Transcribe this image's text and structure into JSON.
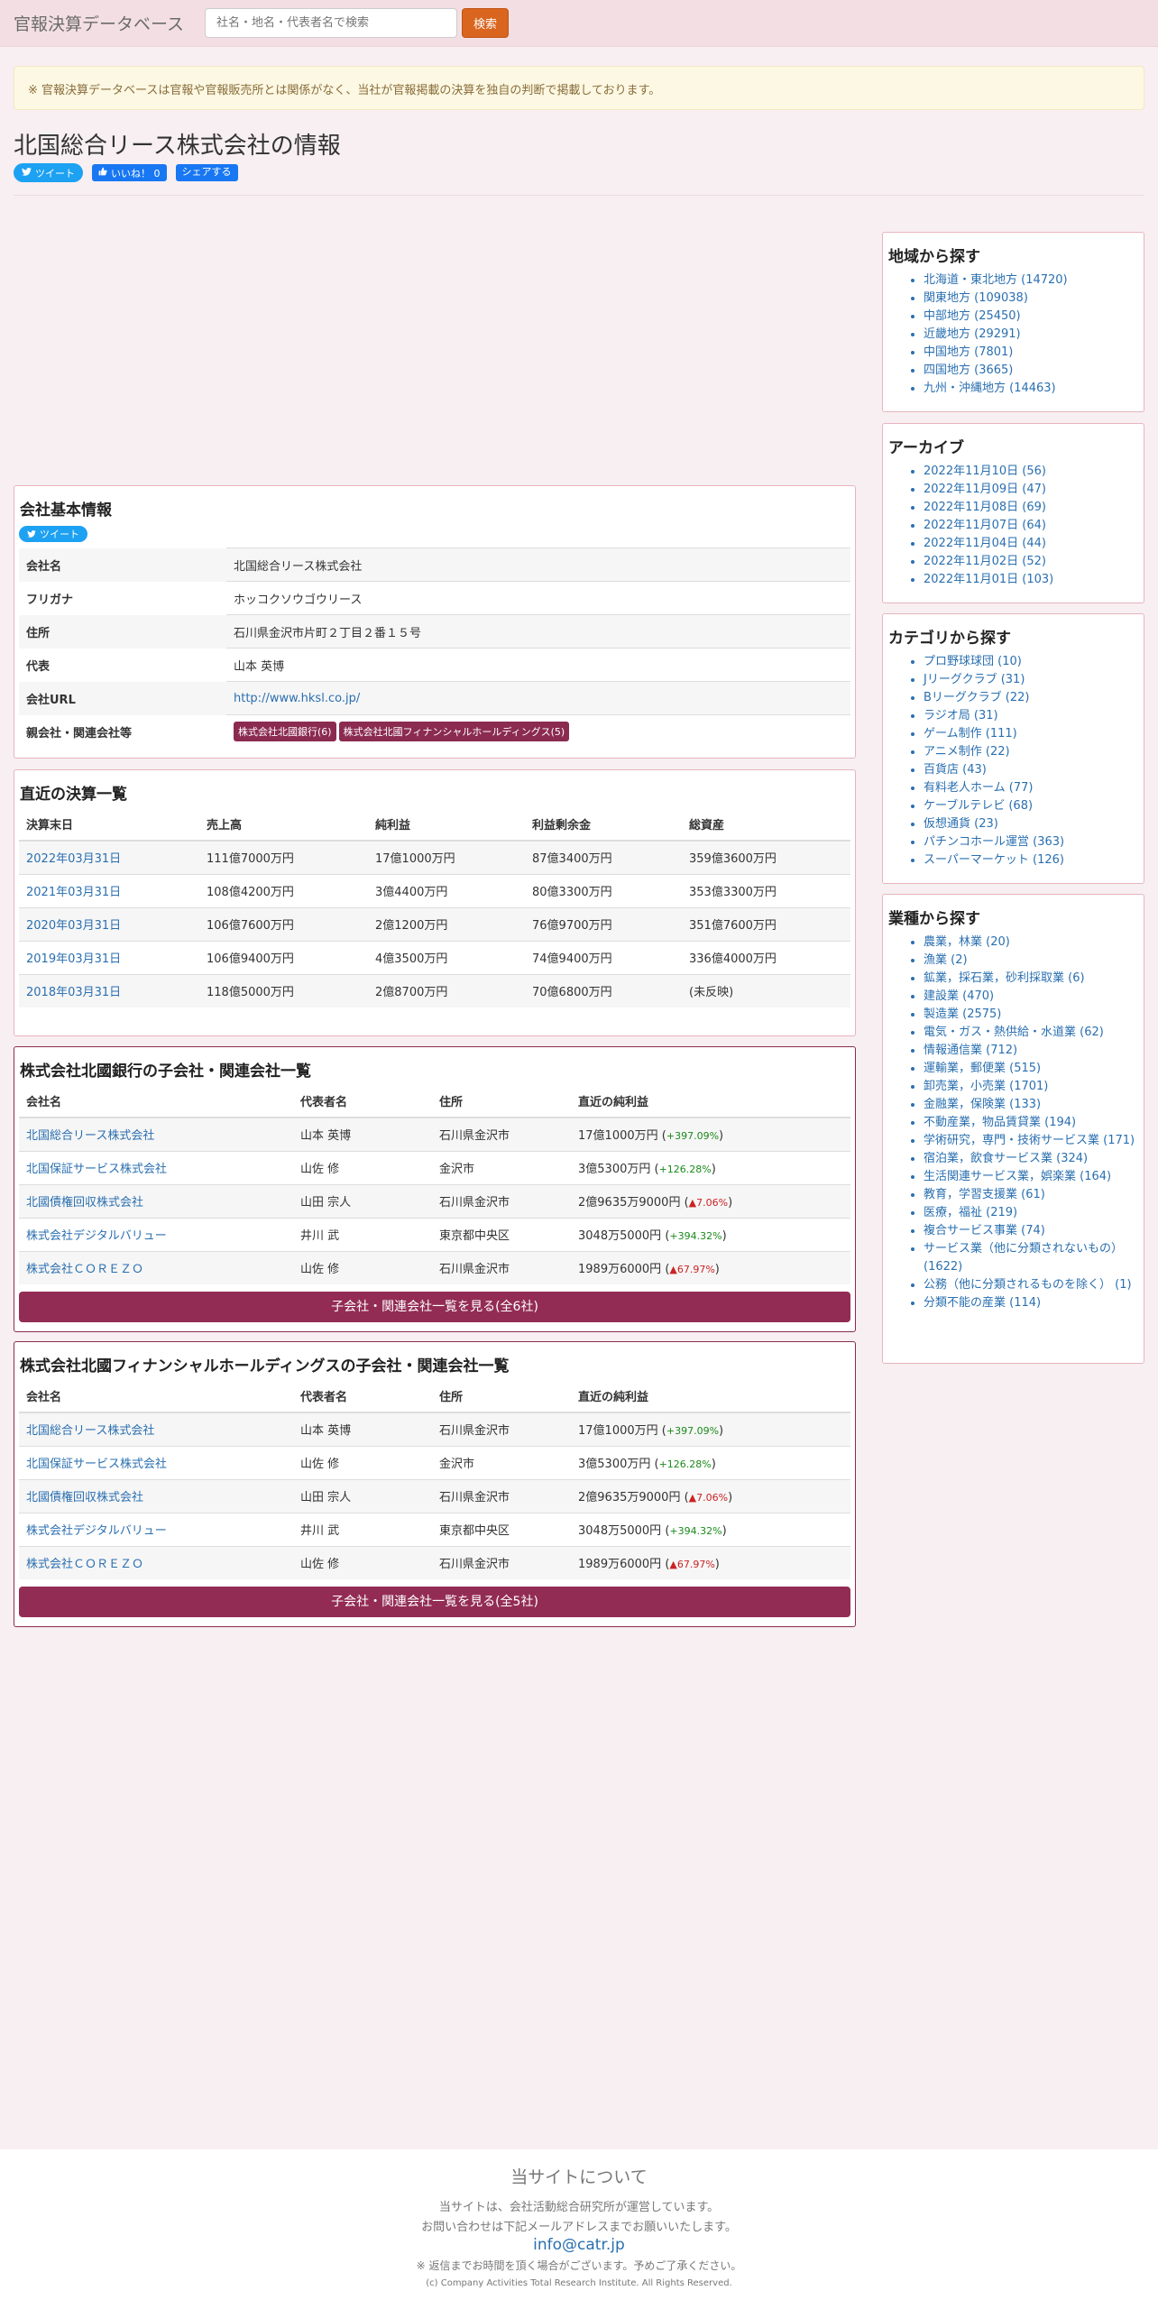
{
  "header": {
    "brand": "官報決算データベース",
    "search_placeholder": "社名・地名・代表者名で検索",
    "search_button": "検索"
  },
  "notice": "※ 官報決算データベースは官報や官報販売所とは関係がなく、当社が官報掲載の決算を独自の判断で掲載しております。",
  "page_title": "北国総合リース株式会社の情報",
  "social": {
    "tweet": "ツイート",
    "like": "いいね！ 0",
    "share": "シェアする"
  },
  "company_info": {
    "title": "会社基本情報",
    "tweet": "ツイート",
    "rows": [
      {
        "label": "会社名",
        "value": "北国総合リース株式会社"
      },
      {
        "label": "フリガナ",
        "value": "ホッコクソウゴウリース"
      },
      {
        "label": "住所",
        "value": "石川県金沢市片町２丁目２番１５号"
      },
      {
        "label": "代表",
        "value": "山本 英博"
      },
      {
        "label": "会社URL",
        "value": "http://www.hksl.co.jp/"
      }
    ],
    "parent_label": "親会社・関連会社等",
    "parents": [
      "株式会社北國銀行(6)",
      "株式会社北國フィナンシャルホールディングス(5)"
    ]
  },
  "financials": {
    "title": "直近の決算一覧",
    "headers": [
      "決算末日",
      "売上高",
      "純利益",
      "利益剰余金",
      "総資産"
    ],
    "rows": [
      [
        "2022年03月31日",
        "111億7000万円",
        "17億1000万円",
        "87億3400万円",
        "359億3600万円"
      ],
      [
        "2021年03月31日",
        "108億4200万円",
        "3億4400万円",
        "80億3300万円",
        "353億3300万円"
      ],
      [
        "2020年03月31日",
        "106億7600万円",
        "2億1200万円",
        "76億9700万円",
        "351億7600万円"
      ],
      [
        "2019年03月31日",
        "106億9400万円",
        "4億3500万円",
        "74億9400万円",
        "336億4000万円"
      ],
      [
        "2018年03月31日",
        "118億5000万円",
        "2億8700万円",
        "70億6800万円",
        "(未反映)"
      ]
    ]
  },
  "subsidiaries": [
    {
      "title": "株式会社北國銀行の子会社・関連会社一覧",
      "headers": [
        "会社名",
        "代表者名",
        "住所",
        "直近の純利益"
      ],
      "rows": [
        {
          "name": "北国総合リース株式会社",
          "rep": "山本 英博",
          "addr": "石川県金沢市",
          "profit": "17億1000万円",
          "change": "+397.09%",
          "dir": "up"
        },
        {
          "name": "北国保証サービス株式会社",
          "rep": "山佐 修",
          "addr": "金沢市",
          "profit": "3億5300万円",
          "change": "+126.28%",
          "dir": "up"
        },
        {
          "name": "北國債権回収株式会社",
          "rep": "山田 宗人",
          "addr": "石川県金沢市",
          "profit": "2億9635万9000円",
          "change": "▲7.06%",
          "dir": "down"
        },
        {
          "name": "株式会社デジタルバリュー",
          "rep": "井川 武",
          "addr": "東京都中央区",
          "profit": "3048万5000円",
          "change": "+394.32%",
          "dir": "up"
        },
        {
          "name": "株式会社ＣＯＲＥＺＯ",
          "rep": "山佐 修",
          "addr": "石川県金沢市",
          "profit": "1989万6000円",
          "change": "▲67.97%",
          "dir": "down"
        }
      ],
      "more": "子会社・関連会社一覧を見る(全6社)"
    },
    {
      "title": "株式会社北國フィナンシャルホールディングスの子会社・関連会社一覧",
      "headers": [
        "会社名",
        "代表者名",
        "住所",
        "直近の純利益"
      ],
      "rows": [
        {
          "name": "北国総合リース株式会社",
          "rep": "山本 英博",
          "addr": "石川県金沢市",
          "profit": "17億1000万円",
          "change": "+397.09%",
          "dir": "up"
        },
        {
          "name": "北国保証サービス株式会社",
          "rep": "山佐 修",
          "addr": "金沢市",
          "profit": "3億5300万円",
          "change": "+126.28%",
          "dir": "up"
        },
        {
          "name": "北國債権回収株式会社",
          "rep": "山田 宗人",
          "addr": "石川県金沢市",
          "profit": "2億9635万9000円",
          "change": "▲7.06%",
          "dir": "down"
        },
        {
          "name": "株式会社デジタルバリュー",
          "rep": "井川 武",
          "addr": "東京都中央区",
          "profit": "3048万5000円",
          "change": "+394.32%",
          "dir": "up"
        },
        {
          "name": "株式会社ＣＯＲＥＺＯ",
          "rep": "山佐 修",
          "addr": "石川県金沢市",
          "profit": "1989万6000円",
          "change": "▲67.97%",
          "dir": "down"
        }
      ],
      "more": "子会社・関連会社一覧を見る(全5社)"
    }
  ],
  "sidebar": {
    "region": {
      "title": "地域から探す",
      "items": [
        "北海道・東北地方 (14720)",
        "関東地方 (109038)",
        "中部地方 (25450)",
        "近畿地方 (29291)",
        "中国地方 (7801)",
        "四国地方 (3665)",
        "九州・沖縄地方 (14463)"
      ]
    },
    "archive": {
      "title": "アーカイブ",
      "items": [
        "2022年11月10日 (56)",
        "2022年11月09日 (47)",
        "2022年11月08日 (69)",
        "2022年11月07日 (64)",
        "2022年11月04日 (44)",
        "2022年11月02日 (52)",
        "2022年11月01日 (103)"
      ]
    },
    "category": {
      "title": "カテゴリから探す",
      "items": [
        "プロ野球球団 (10)",
        "Jリーグクラブ (31)",
        "Bリーグクラブ (22)",
        "ラジオ局 (31)",
        "ゲーム制作 (111)",
        "アニメ制作 (22)",
        "百貨店 (43)",
        "有料老人ホーム (77)",
        "ケーブルテレビ (68)",
        "仮想通貨 (23)",
        "パチンコホール運営 (363)",
        "スーパーマーケット (126)"
      ]
    },
    "industry": {
      "title": "業種から探す",
      "items": [
        "農業，林業 (20)",
        "漁業 (2)",
        "鉱業，採石業，砂利採取業 (6)",
        "建設業 (470)",
        "製造業 (2575)",
        "電気・ガス・熱供給・水道業 (62)",
        "情報通信業 (712)",
        "運輸業，郵便業 (515)",
        "卸売業，小売業 (1701)",
        "金融業，保険業 (133)",
        "不動産業，物品賃貸業 (194)",
        "学術研究，専門・技術サービス業 (171)",
        "宿泊業，飲食サービス業 (324)",
        "生活関連サービス業，娯楽業 (164)",
        "教育，学習支援業 (61)",
        "医療，福祉 (219)",
        "複合サービス事業 (74)",
        "サービス業（他に分類されないもの） (1622)",
        "公務（他に分類されるものを除く） (1)",
        "分類不能の産業 (114)"
      ]
    }
  },
  "footer": {
    "title": "当サイトについて",
    "line1": "当サイトは、会社活動総合研究所が運営しています。",
    "line2": "お問い合わせは下記メールアドレスまでお願いいたします。",
    "email": "info@catr.jp",
    "note": "※ 返信までお時間を頂く場合がございます。予めご了承ください。",
    "copyright": "(c) Company Activities Total Research Institute. All Rights Reserved."
  }
}
